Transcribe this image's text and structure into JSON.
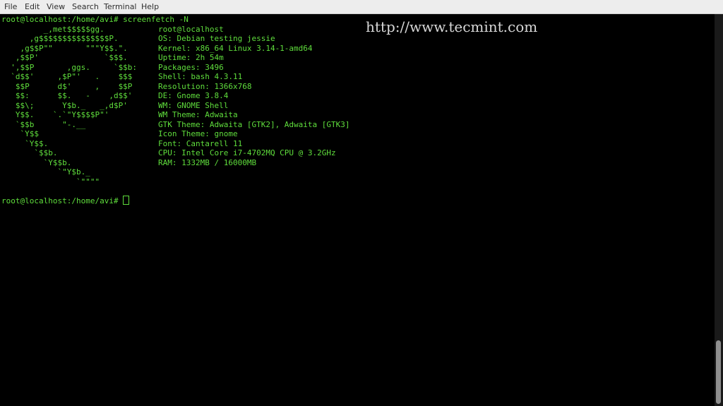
{
  "menubar": {
    "items": [
      {
        "label": "File"
      },
      {
        "label": "Edit"
      },
      {
        "label": "View"
      },
      {
        "label": "Search"
      },
      {
        "label": "Terminal"
      },
      {
        "label": "Help"
      }
    ]
  },
  "terminal": {
    "command_line": "root@localhost:/home/avi# screenfetch -N",
    "logo_lines": [
      "         _,met$$$$$gg.",
      "      ,g$$$$$$$$$$$$$$$P.",
      "    ,g$$P\"\"       \"\"\"Y$$.\".",
      "   ,$$P'              `$$$.",
      "  ',$$P       ,ggs.     `$$b:",
      "  `d$$'     ,$P\"'   .    $$$",
      "   $$P      d$'     ,    $$P",
      "   $$:      $$.   -    ,d$$'",
      "   $$\\;      Y$b._   _,d$P'",
      "   Y$$.    `.`\"Y$$$$P\"'",
      "   `$$b      \"-.__",
      "    `Y$$",
      "     `Y$$.",
      "       `$$b.",
      "         `Y$$b.",
      "            `\"Y$b._",
      "                `\"\"\"\""
    ],
    "info_lines": [
      "root@localhost",
      "OS: Debian testing jessie",
      "Kernel: x86_64 Linux 3.14-1-amd64",
      "Uptime: 2h 54m",
      "Packages: 3496",
      "Shell: bash 4.3.11",
      "Resolution: 1366x768",
      "DE: Gnome 3.8.4",
      "WM: GNOME Shell",
      "WM Theme: Adwaita",
      "GTK Theme: Adwaita [GTK2], Adwaita [GTK3]",
      "Icon Theme: gnome",
      "Font: Cantarell 11",
      "CPU: Intel Core i7-4702MQ CPU @ 3.2GHz",
      "RAM: 1332MB / 16000MB"
    ],
    "prompt": "root@localhost:/home/avi# "
  },
  "watermark": "http://www.tecmint.com",
  "colors": {
    "terminal_bg": "#000000",
    "terminal_fg": "#5fdd3c",
    "menubar_bg": "#ededed"
  }
}
